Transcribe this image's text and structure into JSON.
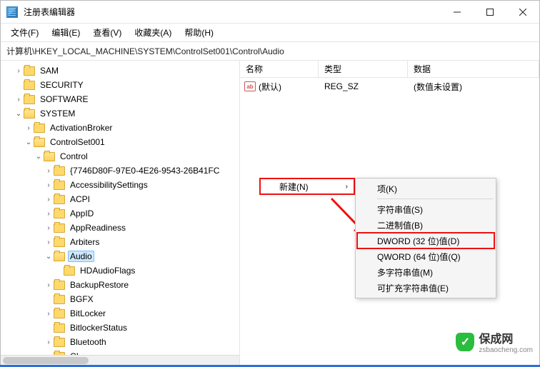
{
  "window": {
    "title": "注册表编辑器"
  },
  "menu": {
    "file": "文件(F)",
    "edit": "编辑(E)",
    "view": "查看(V)",
    "favorites": "收藏夹(A)",
    "help": "帮助(H)"
  },
  "address": "计算机\\HKEY_LOCAL_MACHINE\\SYSTEM\\ControlSet001\\Control\\Audio",
  "columns": {
    "name": "名称",
    "type": "类型",
    "data": "数据"
  },
  "rows": [
    {
      "name": "(默认)",
      "type": "REG_SZ",
      "data": "(数值未设置)"
    }
  ],
  "tree": {
    "sam": "SAM",
    "security": "SECURITY",
    "software": "SOFTWARE",
    "system": "SYSTEM",
    "activationbroker": "ActivationBroker",
    "controlset001": "ControlSet001",
    "control": "Control",
    "guid": "{7746D80F-97E0-4E26-9543-26B41FC",
    "accessibility": "AccessibilitySettings",
    "acpi": "ACPI",
    "appid": "AppID",
    "appreadiness": "AppReadiness",
    "arbiters": "Arbiters",
    "audio": "Audio",
    "hdaudioflags": "HDAudioFlags",
    "backuprestore": "BackupRestore",
    "bgfx": "BGFX",
    "bitlocker": "BitLocker",
    "bitlockerstatus": "BitlockerStatus",
    "bluetooth": "Bluetooth",
    "ci": "CI"
  },
  "context": {
    "new": "新建(N)"
  },
  "submenu": {
    "key": "项(K)",
    "string": "字符串值(S)",
    "binary": "二进制值(B)",
    "dword": "DWORD (32 位)值(D)",
    "qword": "QWORD (64 位)值(Q)",
    "multi": "多字符串值(M)",
    "expand": "可扩充字符串值(E)"
  },
  "watermark": {
    "text": "保成网",
    "sub": "zsbaocheng.com",
    "shield": "✓"
  },
  "icons": {
    "strval": "ab"
  }
}
